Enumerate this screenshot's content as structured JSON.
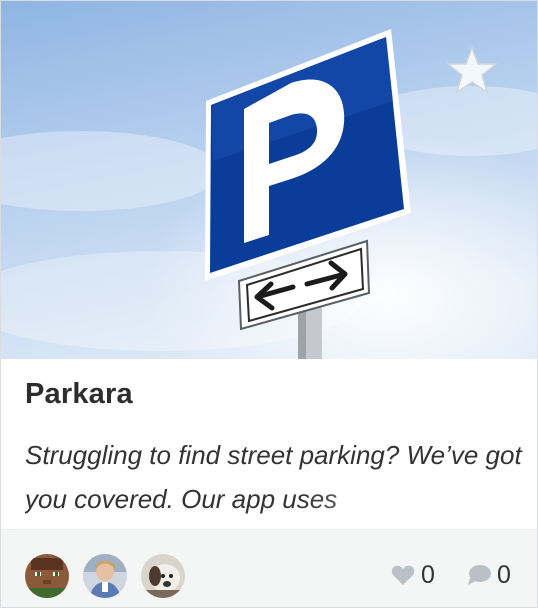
{
  "project": {
    "title": "Parkara",
    "description": "Struggling to find street parking? We’ve got you covered. Our app uses"
  },
  "hero": {
    "sign_letter": "P",
    "image_description_icon": "parking-sign-image"
  },
  "actions": {
    "favorite_icon": "star-icon"
  },
  "footer": {
    "avatars": [
      "avatar-pixel-character",
      "avatar-photo-person",
      "avatar-photo-dog"
    ],
    "likes": "0",
    "comments": "0",
    "like_icon": "heart-icon",
    "comment_icon": "speech-bubble-icon"
  },
  "colors": {
    "sign_blue": "#0a3d9a",
    "sky_light": "#cfe0f2",
    "footer_bg": "#f4f6f6",
    "title_text": "#2d2d2d",
    "icon_grey": "#b9c0c6"
  }
}
